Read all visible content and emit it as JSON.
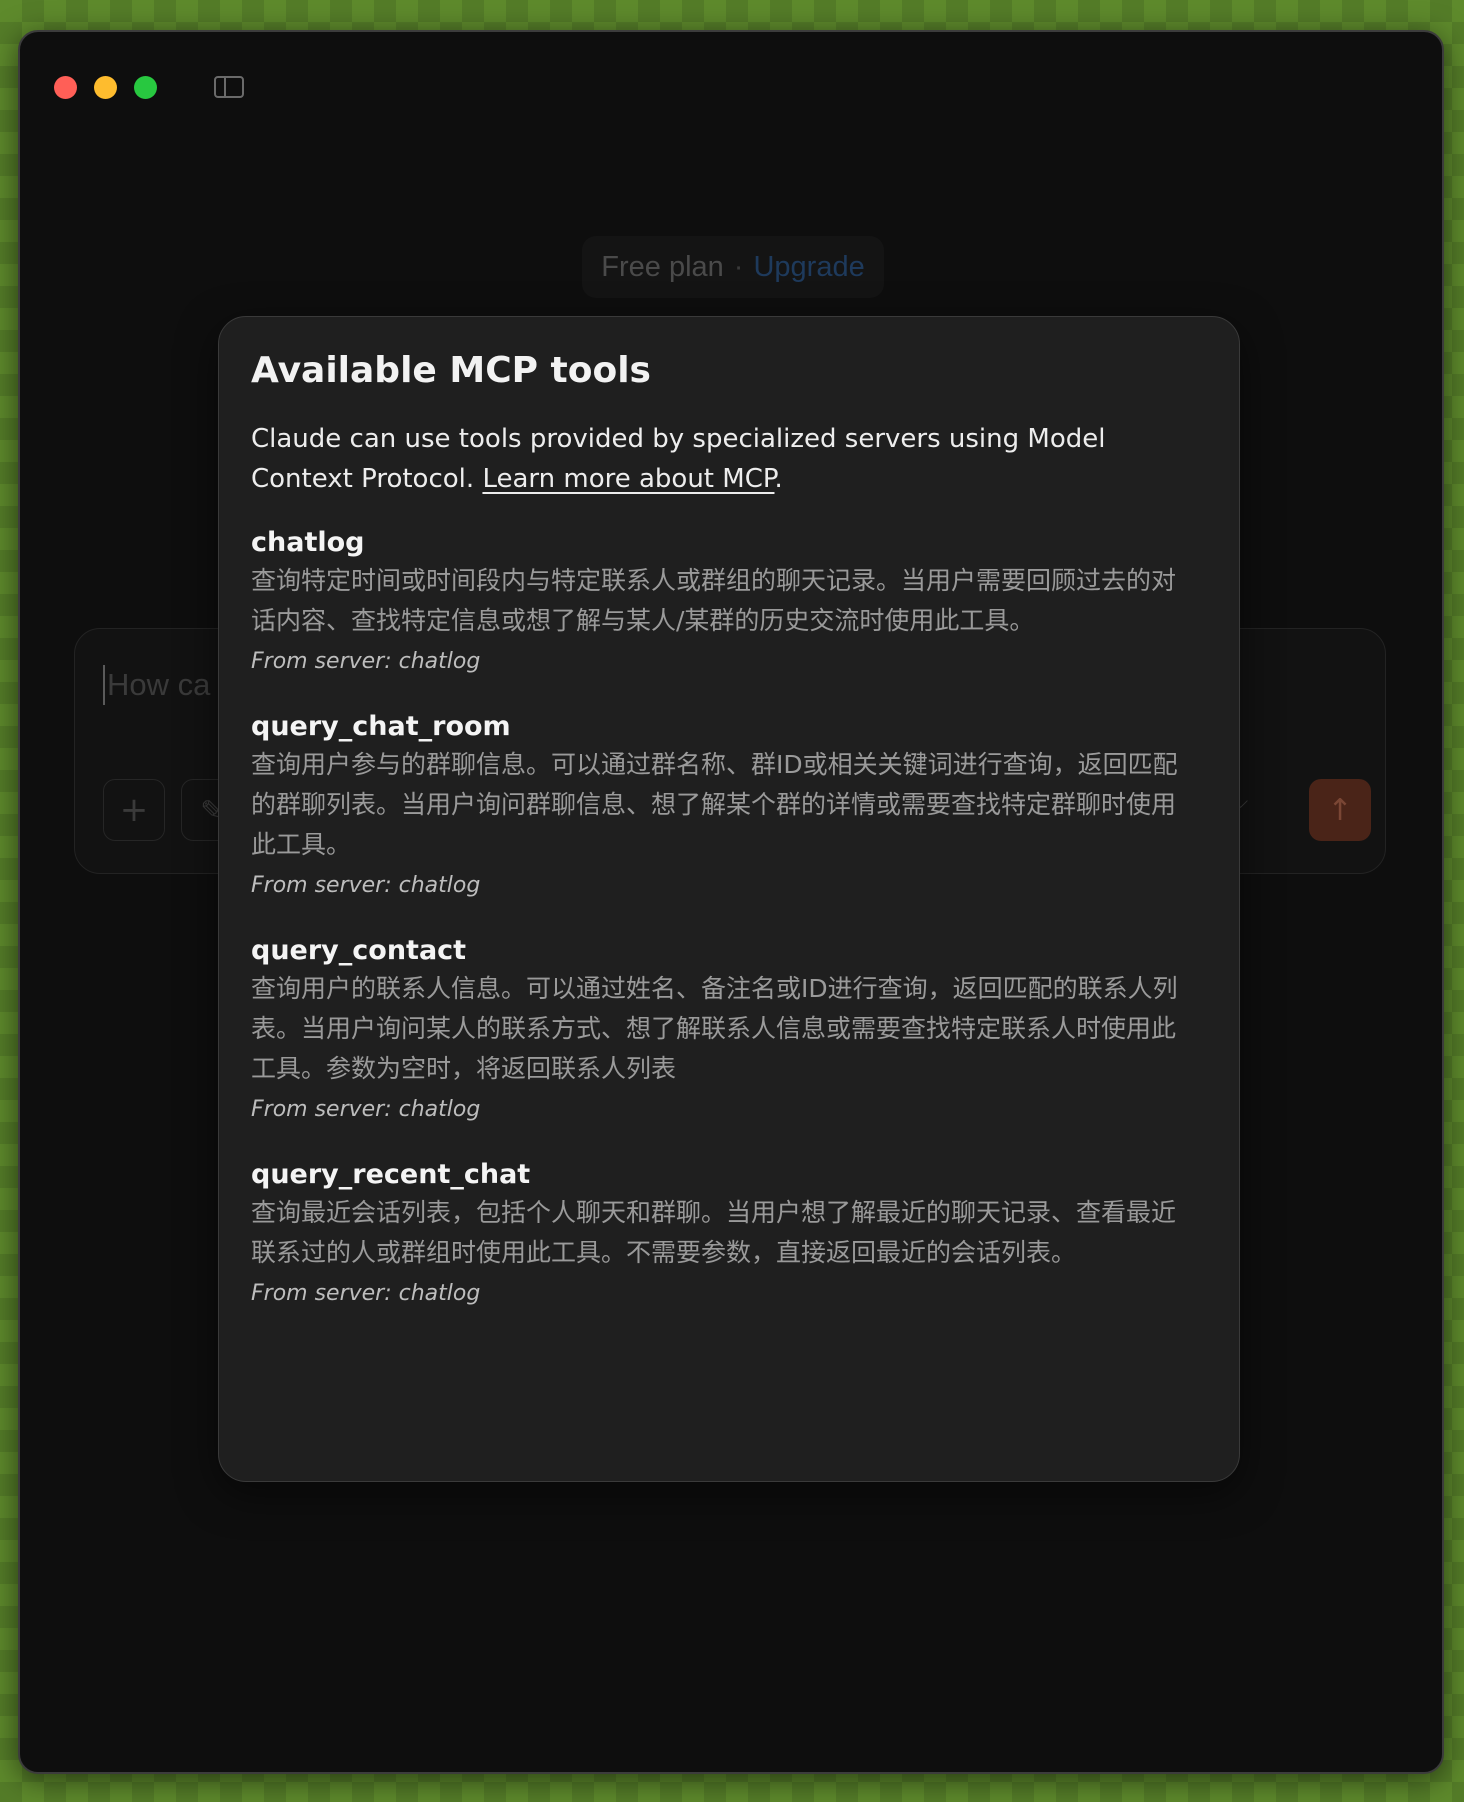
{
  "window": {
    "controls": {
      "close_color": "#ff5f57",
      "minimize_color": "#febc2e",
      "zoom_color": "#28c840"
    },
    "sidebar_toggle_icon": "sidebar-icon"
  },
  "plan_badge": {
    "plan_label": "Free plan",
    "separator": "·",
    "upgrade_label": "Upgrade"
  },
  "composer": {
    "placeholder_visible": "How ca",
    "add_icon_glyph": "+",
    "style_icon_glyph": "✎",
    "chevron_glyph": "⌵",
    "send_icon_glyph": "↑",
    "send_color": "#4a2418"
  },
  "modal": {
    "title": "Available MCP tools",
    "description_prefix": "Claude can use tools provided by specialized servers using Model Context Protocol. ",
    "learn_more_link": "Learn more about MCP",
    "description_suffix": ".",
    "tools": [
      {
        "name": "chatlog",
        "description": "查询特定时间或时间段内与特定联系人或群组的聊天记录。当用户需要回顾过去的对话内容、查找特定信息或想了解与某人/某群的历史交流时使用此工具。",
        "server": "From server: chatlog"
      },
      {
        "name": "query_chat_room",
        "description": "查询用户参与的群聊信息。可以通过群名称、群ID或相关关键词进行查询，返回匹配的群聊列表。当用户询问群聊信息、想了解某个群的详情或需要查找特定群聊时使用此工具。",
        "server": "From server: chatlog"
      },
      {
        "name": "query_contact",
        "description": "查询用户的联系人信息。可以通过姓名、备注名或ID进行查询，返回匹配的联系人列表。当用户询问某人的联系方式、想了解联系人信息或需要查找特定联系人时使用此工具。参数为空时，将返回联系人列表",
        "server": "From server: chatlog"
      },
      {
        "name": "query_recent_chat",
        "description": "查询最近会话列表，包括个人聊天和群聊。当用户想了解最近的聊天记录、查看最近联系过的人或群组时使用此工具。不需要参数，直接返回最近的会话列表。",
        "server": "From server: chatlog"
      }
    ]
  }
}
